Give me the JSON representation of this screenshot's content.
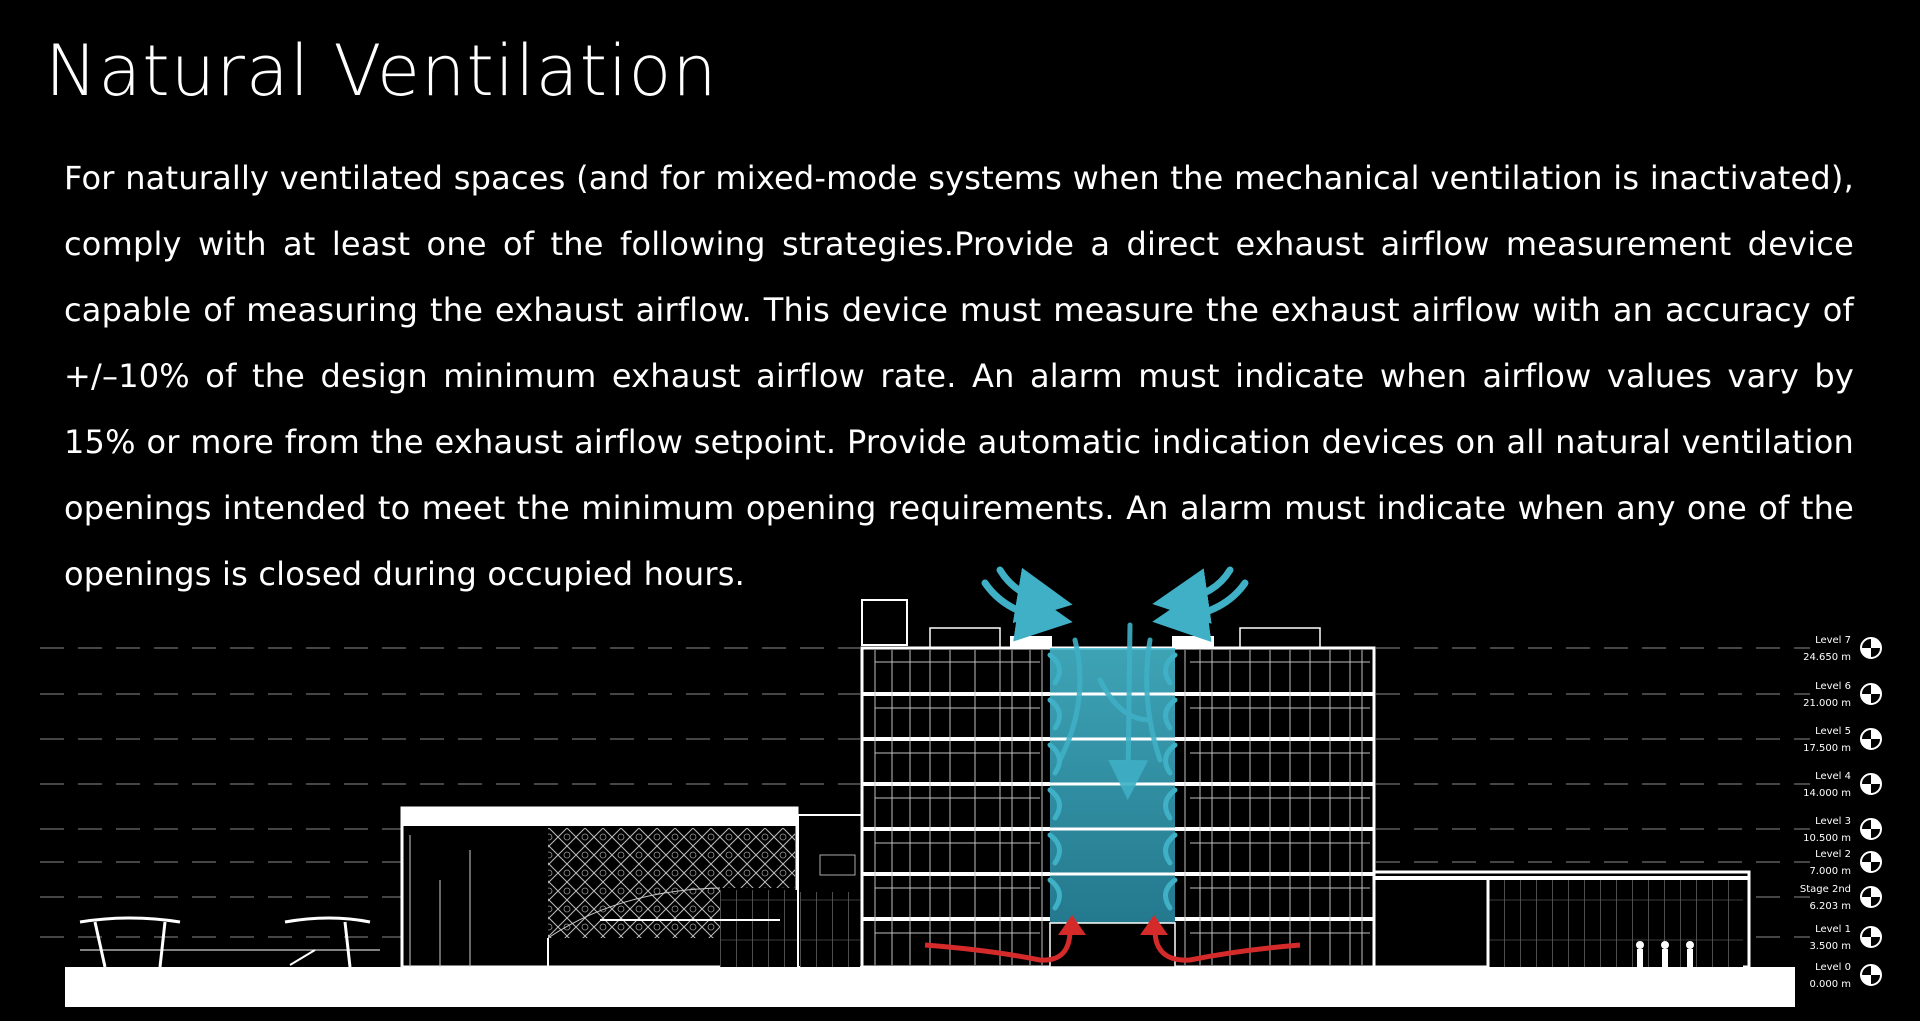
{
  "title": "Natural Ventilation",
  "body": "For naturally ventilated spaces (and for mixed-mode systems when the mechanical ventilation is inactivated), comply with at least one of the following strategies.Provide a direct exhaust airflow measurement device capable of measuring the exhaust airflow. This device must measure the exhaust airflow with an accuracy of +/–10% of the design minimum exhaust airflow rate. An alarm must indicate when airflow values vary by 15% or more from the exhaust airflow setpoint. Provide automatic indication devices on all natural ventilation openings intended to meet the minimum opening requirements. An alarm must indicate when any one of the openings is closed during occupied hours.",
  "levels": [
    {
      "name": "Level 7",
      "elevation": "24.650 m"
    },
    {
      "name": "Level 6",
      "elevation": "21.000 m"
    },
    {
      "name": "Level 5",
      "elevation": "17.500 m"
    },
    {
      "name": "Level 4",
      "elevation": "14.000 m"
    },
    {
      "name": "Level 3",
      "elevation": "10.500 m"
    },
    {
      "name": "Level 2",
      "elevation": "7.000 m"
    },
    {
      "name": "Stage 2nd",
      "elevation": "6.203 m"
    },
    {
      "name": "Level 1",
      "elevation": "3.500 m"
    },
    {
      "name": "Level 0",
      "elevation": "0.000 m"
    }
  ],
  "colors": {
    "background": "#000000",
    "lines": "#ffffff",
    "atrium_fill": "#3fb0c6",
    "air_arrows": "#3fb0c6",
    "warm_air_arrows": "#d42a2a"
  },
  "icons": [
    "level-marker-icon",
    "cool-air-arrow-icon",
    "warm-air-arrow-icon"
  ]
}
